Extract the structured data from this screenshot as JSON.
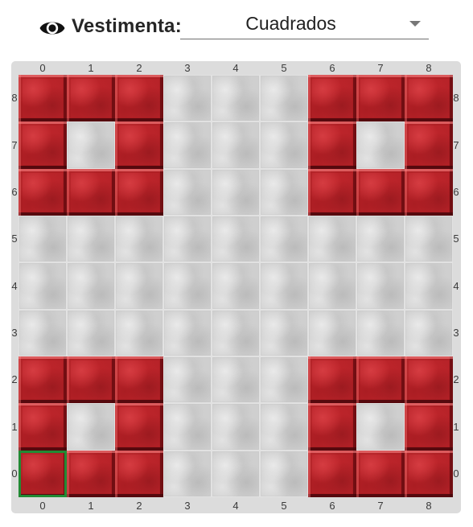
{
  "header": {
    "visibility_icon": "eye-icon",
    "outfit_label": "Vestimenta:",
    "outfit_value": "Cuadrados",
    "dropdown_icon": "chevron-down-icon"
  },
  "board": {
    "column_labels": [
      "0",
      "1",
      "2",
      "3",
      "4",
      "5",
      "6",
      "7",
      "8"
    ],
    "row_labels_top_to_bottom": [
      "8",
      "7",
      "6",
      "5",
      "4",
      "3",
      "2",
      "1",
      "0"
    ],
    "rows_top_to_bottom": [
      [
        1,
        1,
        1,
        0,
        0,
        0,
        1,
        1,
        1
      ],
      [
        1,
        0,
        1,
        0,
        0,
        0,
        1,
        0,
        1
      ],
      [
        1,
        1,
        1,
        0,
        0,
        0,
        1,
        1,
        1
      ],
      [
        0,
        0,
        0,
        0,
        0,
        0,
        0,
        0,
        0
      ],
      [
        0,
        0,
        0,
        0,
        0,
        0,
        0,
        0,
        0
      ],
      [
        0,
        0,
        0,
        0,
        0,
        0,
        0,
        0,
        0
      ],
      [
        1,
        1,
        1,
        0,
        0,
        0,
        1,
        1,
        1
      ],
      [
        1,
        0,
        1,
        0,
        0,
        0,
        1,
        0,
        1
      ],
      [
        1,
        1,
        1,
        0,
        0,
        0,
        1,
        1,
        1
      ]
    ],
    "cell_legend": {
      "0": "empty-stone",
      "1": "red-piece"
    },
    "selected_cell": {
      "col": 0,
      "row": 0
    },
    "colors": {
      "piece": "#b82329",
      "stone": "#cfcfcf",
      "board_frame": "#dcdcdc",
      "selection": "#228a34"
    }
  }
}
